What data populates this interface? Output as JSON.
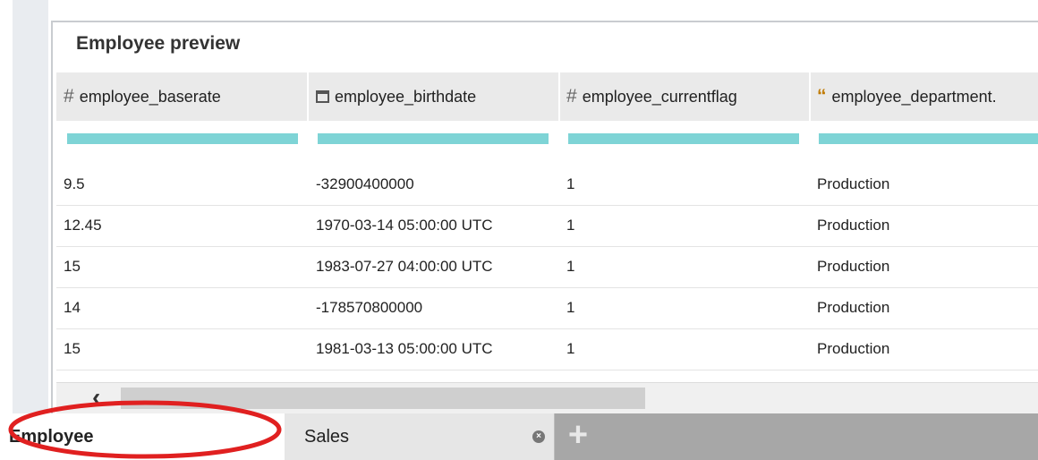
{
  "panel": {
    "title": "Employee preview"
  },
  "columns": [
    {
      "label": "employee_baserate",
      "type_icon": "#",
      "icon_name": "number-icon"
    },
    {
      "label": "employee_birthdate",
      "type_icon": "calendar",
      "icon_name": "calendar-icon"
    },
    {
      "label": "employee_currentflag",
      "type_icon": "#",
      "icon_name": "number-icon"
    },
    {
      "label": "employee_department.",
      "type_icon": "“",
      "icon_name": "text-icon"
    }
  ],
  "rows": [
    [
      "9.5",
      "-32900400000",
      "1",
      "Production"
    ],
    [
      "12.45",
      "1970-03-14 05:00:00 UTC",
      "1",
      "Production"
    ],
    [
      "15",
      "1983-07-27 04:00:00 UTC",
      "1",
      "Production"
    ],
    [
      "14",
      "-178570800000",
      "1",
      "Production"
    ],
    [
      "15",
      "1981-03-13 05:00:00 UTC",
      "1",
      "Production"
    ]
  ],
  "tabs": [
    {
      "label": "Employee",
      "active": true
    },
    {
      "label": "Sales",
      "active": false
    }
  ],
  "colors": {
    "column_bar": "#7ed4d6",
    "annotation": "#e02020",
    "tabbar": "#a7a7a7"
  }
}
